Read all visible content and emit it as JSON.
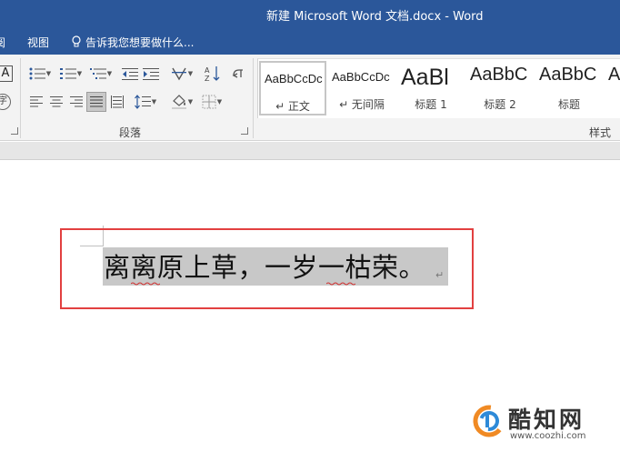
{
  "window": {
    "title": "新建 Microsoft Word 文档.docx - Word"
  },
  "menu": {
    "left_item": "阅",
    "view": "视图",
    "tell_me": "告诉我您想要做什么..."
  },
  "ribbon": {
    "paragraph_group": "段落",
    "styles_group": "样式",
    "partial_font_icon": "A",
    "partial_phonetic": "字",
    "styles": [
      {
        "preview": "AaBbCcDc",
        "name": "↵ 正文",
        "size": "13px",
        "active": true
      },
      {
        "preview": "AaBbCcDc",
        "name": "↵ 无间隔",
        "size": "13px",
        "active": false
      },
      {
        "preview": "AaBl",
        "name": "标题 1",
        "size": "25px",
        "active": false
      },
      {
        "preview": "AaBbC",
        "name": "标题 2",
        "size": "20px",
        "active": false
      },
      {
        "preview": "AaBbC",
        "name": "标题",
        "size": "20px",
        "active": false
      },
      {
        "preview": "A",
        "name": "",
        "size": "20px",
        "active": false
      }
    ]
  },
  "document": {
    "text": "离离原上草，一岁一枯荣。",
    "paragraph_mark": "↵"
  },
  "watermark": {
    "name": "酷知网",
    "url": "www.coozhi.com"
  },
  "colors": {
    "title_bar": "#2b579a",
    "highlight_box": "#e24040",
    "selection": "#c8c8c8",
    "spell_squiggle": "#d03030",
    "logo_orange": "#f08a24",
    "logo_blue": "#2e8ad8"
  },
  "icons": [
    "lightbulb-icon",
    "bullets-icon",
    "numbering-icon",
    "multilevel-list-icon",
    "decrease-indent-icon",
    "increase-indent-icon",
    "chinese-layout-icon",
    "sort-icon",
    "show-marks-icon",
    "align-left-icon",
    "align-center-icon",
    "align-right-icon",
    "justify-icon",
    "distributed-icon",
    "line-spacing-icon",
    "shading-icon",
    "borders-icon",
    "dialog-launcher-icon"
  ]
}
